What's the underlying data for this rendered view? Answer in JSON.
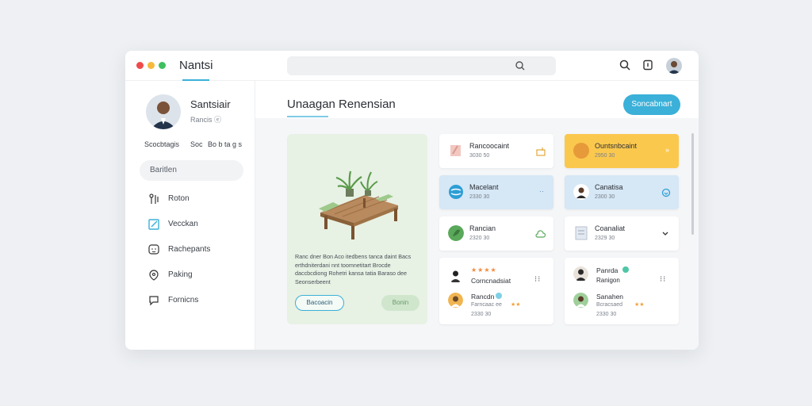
{
  "window": {
    "title": "Nantsi"
  },
  "search": {
    "placeholder": ""
  },
  "profile": {
    "name": "Santsiair",
    "subtitle": "Rancis ⓔ",
    "stats": [
      "Scocbtagis",
      "Soc",
      "Bo b ta g s"
    ]
  },
  "sidebar": {
    "search_label": "Baritlen",
    "items": [
      {
        "label": "Roton",
        "icon": "people-icon"
      },
      {
        "label": "Vecckan",
        "icon": "edit-icon"
      },
      {
        "label": "Rachepants",
        "icon": "chat-icon"
      },
      {
        "label": "Paking",
        "icon": "pin-icon"
      },
      {
        "label": "Fornicns",
        "icon": "comment-icon"
      }
    ]
  },
  "main": {
    "title": "Unaagan Renensian",
    "primary_button": "Soncabnart"
  },
  "hero": {
    "text": "Ranc dner Bon Aco itedbens tanca daint Bacs erthdniterdani nnt toomnetitart Brocde daccbcdiong Rohetri kansa tatia Baraso dee Seonserbeent",
    "button_primary": "Bacoacin",
    "button_secondary": "Bonin"
  },
  "cards": [
    {
      "title": "Rancoocaint",
      "sub": "3030 50",
      "icon": "box-icon",
      "color": "#ffffff"
    },
    {
      "title": "Ountsnbcaint",
      "sub": "2950 30",
      "icon": "coin-icon",
      "color": "#fbc84e"
    },
    {
      "title": "Macelant",
      "sub": "2330 30",
      "icon": "globe-icon",
      "color": "#d6e7f5"
    },
    {
      "title": "Canatisa",
      "sub": "2300 30",
      "icon": "user-icon",
      "color": "#d6e7f5"
    },
    {
      "title": "Rancian",
      "sub": "2320 30",
      "icon": "leaf-icon",
      "color": "#ffffff"
    },
    {
      "title": "Coanaliat",
      "sub": "2329 30",
      "icon": "doc-icon",
      "color": "#ffffff"
    }
  ],
  "list_left": {
    "stars": "★★★★",
    "row1": "Corncnadsiat",
    "row2": "Rancdn",
    "row2_sub": "Farncaac ee",
    "row3": "2330 30"
  },
  "list_right": {
    "row1": "Panrda",
    "row1_sub": "Ranigon",
    "row2": "Sanahen",
    "row2_sub": "Bcracsaed",
    "row3": "2330 30"
  },
  "colors": {
    "accent": "#3bb0d8",
    "yellow": "#fbc84e",
    "light_blue": "#d6e7f5",
    "green_bg": "#e7f1e4"
  }
}
